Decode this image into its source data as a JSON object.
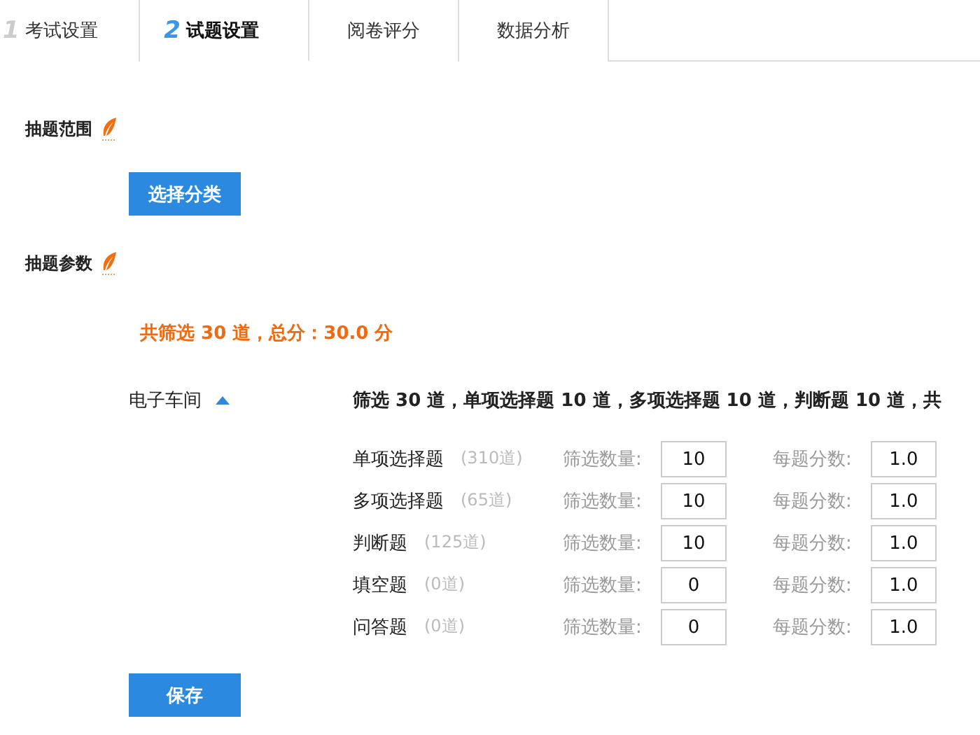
{
  "tabs": [
    {
      "number": "1",
      "label": "考试设置",
      "selected": false
    },
    {
      "number": "2",
      "label": "试题设置",
      "selected": true
    },
    {
      "label": "阅卷评分",
      "selected": false
    },
    {
      "label": "数据分析",
      "selected": false
    }
  ],
  "scope": {
    "title": "抽题范围",
    "button": "选择分类"
  },
  "params": {
    "title": "抽题参数",
    "total": "共筛选 30 道，总分：30.0 分",
    "category": {
      "name": "电子车间",
      "expanded": true,
      "summary": "筛选 30 道，单项选择题 10 道，多项选择题 10 道，判断题 10 道，共",
      "rows": [
        {
          "type": "单项选择题",
          "available": "(310道)",
          "count_label": "筛选数量:",
          "count": "10",
          "score_label": "每题分数:",
          "score": "1.0"
        },
        {
          "type": "多项选择题",
          "available": "(65道)",
          "count_label": "筛选数量:",
          "count": "10",
          "score_label": "每题分数:",
          "score": "1.0"
        },
        {
          "type": "判断题",
          "available": "(125道)",
          "count_label": "筛选数量:",
          "count": "10",
          "score_label": "每题分数:",
          "score": "1.0"
        },
        {
          "type": "填空题",
          "available": "(0道)",
          "count_label": "筛选数量:",
          "count": "0",
          "score_label": "每题分数:",
          "score": "1.0"
        },
        {
          "type": "问答题",
          "available": "(0道)",
          "count_label": "筛选数量:",
          "count": "0",
          "score_label": "每题分数:",
          "score": "1.0"
        }
      ]
    }
  },
  "save_button": "保存"
}
